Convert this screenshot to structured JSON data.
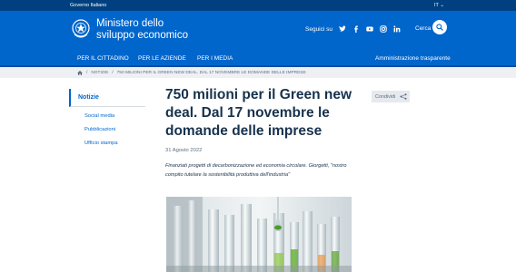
{
  "topbar": {
    "gov": "Governo Italiano",
    "lang": "IT ⌄"
  },
  "header": {
    "brand_line1": "Ministero dello",
    "brand_line2": "sviluppo economico",
    "follow": "Seguici su",
    "social_icons": [
      "twitter-icon",
      "facebook-icon",
      "youtube-icon",
      "instagram-icon",
      "linkedin-icon"
    ],
    "search_label": "Cerca"
  },
  "nav": {
    "items": [
      "PER IL CITTADINO",
      "PER LE AZIENDE",
      "PER I MEDIA"
    ],
    "right": "Amministrazione trasparente"
  },
  "breadcrumb": {
    "sep1": "/",
    "notizie": "NOTIZIE",
    "sep2": "/",
    "current": "750 MILIONI PER IL GREEN NEW DEAL. DAL 17 NOVEMBRE LE DOMANDE DELLE IMPRESE"
  },
  "sidebar": {
    "heading": "Notizie",
    "links": [
      "Social media",
      "Pubblicazioni",
      "Ufficio stampa"
    ]
  },
  "article": {
    "title": "750 milioni per il Green new deal. Dal 17 novembre le domande delle imprese",
    "date": "31 Agosto 2022",
    "lead": "Finanziati progetti di decarbonizzazione ed economia circolare. Giorgetti, \"nostro compito tutelare la sostenibilità produttiva dell'industria\""
  },
  "share": {
    "label": "Condividi"
  },
  "colors": {
    "primary": "#0066cc",
    "topbar": "#004080",
    "text": "#17324d",
    "muted": "#5c6f82"
  }
}
